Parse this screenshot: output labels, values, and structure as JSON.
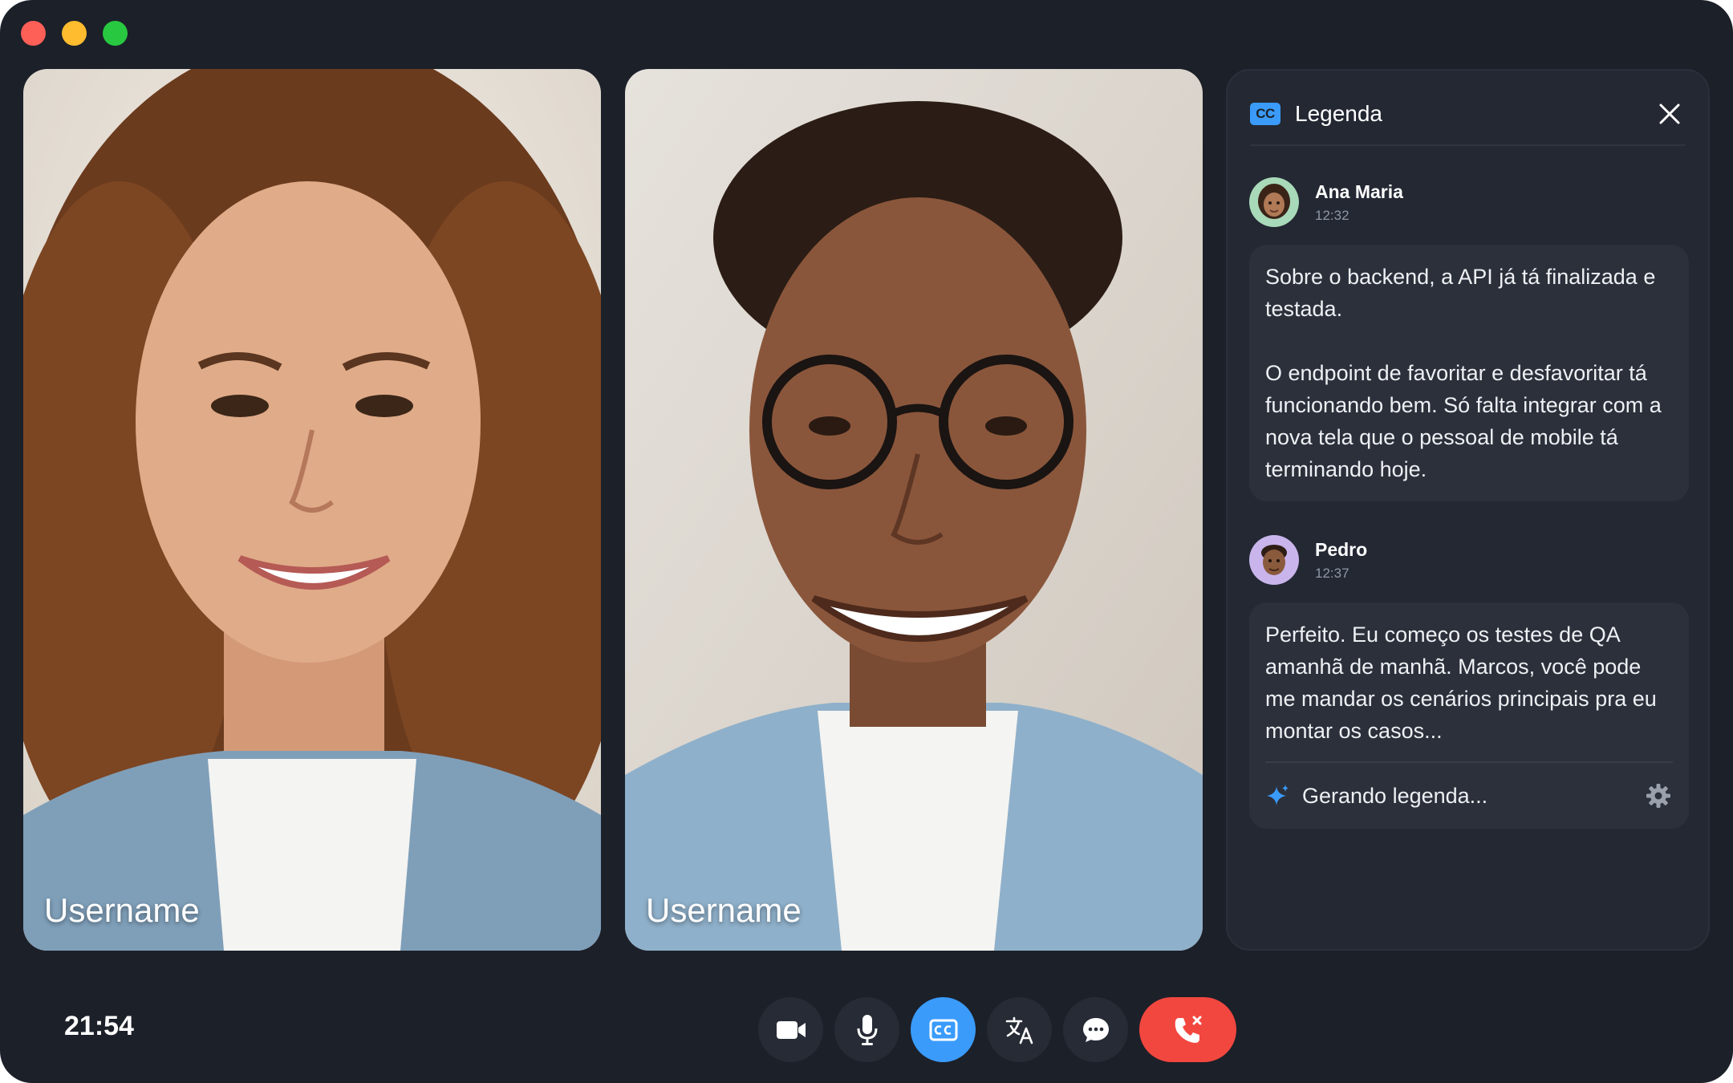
{
  "window": {
    "traffic_lights": [
      "close",
      "minimize",
      "maximize"
    ]
  },
  "participants": [
    {
      "name": "Username"
    },
    {
      "name": "Username"
    }
  ],
  "captions_panel": {
    "title": "Legenda",
    "badge": "CC",
    "messages": [
      {
        "speaker": "Ana Maria",
        "time": "12:32",
        "paragraphs": [
          "Sobre o backend, a API já tá finalizada e testada.",
          "O endpoint de favoritar e desfavoritar tá funcionando bem. Só falta integrar com a nova tela que o pessoal de mobile tá terminando hoje."
        ]
      },
      {
        "speaker": "Pedro",
        "time": "12:37",
        "paragraphs": [
          "Perfeito. Eu começo os testes de QA amanhã de manhã. Marcos, você pode me mandar os cenários principais pra eu montar os casos..."
        ]
      }
    ],
    "status": "Gerando legenda..."
  },
  "call_bar": {
    "clock": "21:54",
    "controls": [
      "video-icon",
      "mic-icon",
      "cc-icon",
      "translate-icon",
      "chat-icon",
      "hangup-icon"
    ],
    "active_control": "cc-icon"
  },
  "colors": {
    "background": "#1c2029",
    "panel": "#232833",
    "bubble": "#2b303b",
    "accent": "#3a9bfb",
    "hangup": "#f2473f"
  }
}
